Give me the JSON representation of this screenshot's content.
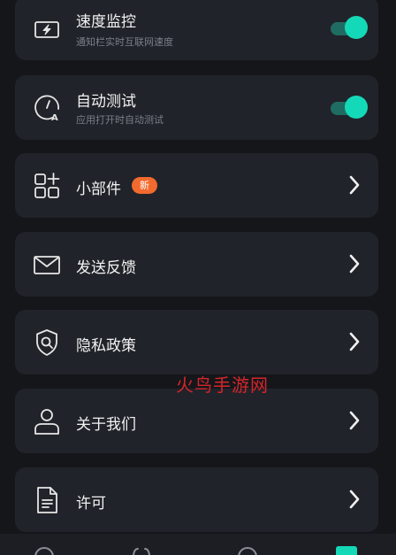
{
  "settings": {
    "speed_monitor": {
      "title": "速度监控",
      "subtitle": "通知栏实时互联网速度",
      "enabled": true
    },
    "auto_test": {
      "title": "自动测试",
      "subtitle": "应用打开时自动测试",
      "enabled": true
    },
    "widgets": {
      "title": "小部件",
      "badge": "新"
    },
    "feedback": {
      "title": "发送反馈"
    },
    "privacy": {
      "title": "隐私政策"
    },
    "about": {
      "title": "关于我们"
    },
    "license": {
      "title": "许可"
    }
  },
  "watermark": "火鸟手游网",
  "bottom_nav": {
    "items": [
      "speed-icon",
      "chart-icon",
      "history-icon",
      "settings-icon"
    ],
    "active_index": 3
  },
  "colors": {
    "background": "#15161a",
    "card": "#21232a",
    "accent": "#14d9b8",
    "badge": "#f26a2e",
    "watermark": "#d3262b"
  }
}
